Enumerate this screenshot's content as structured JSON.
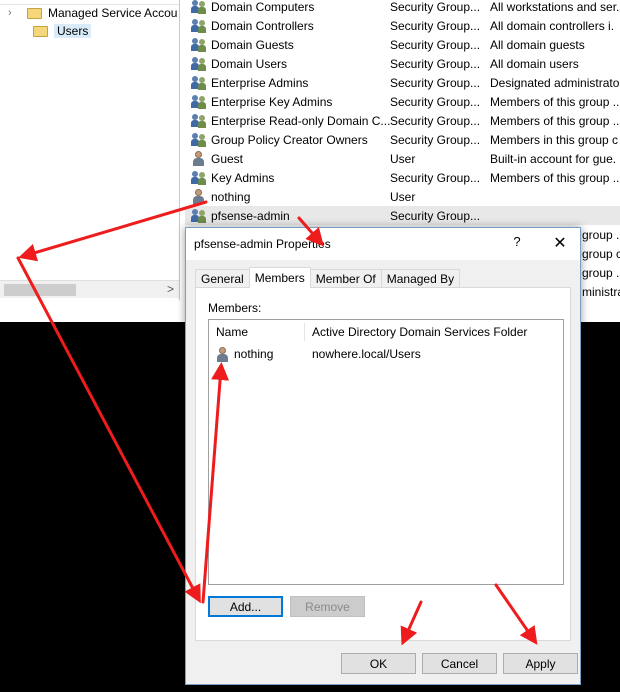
{
  "tree": {
    "items": [
      {
        "label": "Managed Service Accou",
        "icon": "folder-icon",
        "selected": false
      },
      {
        "label": "Users",
        "icon": "folder-icon",
        "selected": true
      }
    ],
    "scroll_right": ">"
  },
  "list": {
    "rows": [
      {
        "name": "Domain Computers",
        "type": "Security Group...",
        "desc": "All workstations and ser.",
        "icon": "group"
      },
      {
        "name": "Domain Controllers",
        "type": "Security Group...",
        "desc": "All domain controllers i.",
        "icon": "group"
      },
      {
        "name": "Domain Guests",
        "type": "Security Group...",
        "desc": "All domain guests",
        "icon": "group"
      },
      {
        "name": "Domain Users",
        "type": "Security Group...",
        "desc": "All domain users",
        "icon": "group"
      },
      {
        "name": "Enterprise Admins",
        "type": "Security Group...",
        "desc": "Designated administrato",
        "icon": "group"
      },
      {
        "name": "Enterprise Key Admins",
        "type": "Security Group...",
        "desc": "Members of this group ...",
        "icon": "group"
      },
      {
        "name": "Enterprise Read-only Domain C...",
        "type": "Security Group...",
        "desc": "Members of this group ...",
        "icon": "group"
      },
      {
        "name": "Group Policy Creator Owners",
        "type": "Security Group...",
        "desc": "Members in this group c",
        "icon": "group"
      },
      {
        "name": "Guest",
        "type": "User",
        "desc": "Built-in account for gue.",
        "icon": "user"
      },
      {
        "name": "Key Admins",
        "type": "Security Group...",
        "desc": "Members of this group ...",
        "icon": "group"
      },
      {
        "name": "nothing",
        "type": "User",
        "desc": "",
        "icon": "user"
      },
      {
        "name": "pfsense-admin",
        "type": "Security Group...",
        "desc": "",
        "icon": "group"
      }
    ],
    "clipped_right": [
      "group ...",
      "group can",
      "group ...",
      "ministrato"
    ]
  },
  "dialog": {
    "title": "pfsense-admin Properties",
    "help": "?",
    "close": "✕",
    "tabs": [
      "General",
      "Members",
      "Member Of",
      "Managed By"
    ],
    "active_tab": "Members",
    "members_label": "Members:",
    "columns": {
      "name": "Name",
      "folder": "Active Directory Domain Services Folder"
    },
    "members": [
      {
        "name": "nothing",
        "folder": "nowhere.local/Users"
      }
    ],
    "add_button": "Add...",
    "remove_button": "Remove",
    "ok_button": "OK",
    "cancel_button": "Cancel",
    "apply_button": "Apply"
  },
  "colors": {
    "annotation_arrow": "#ee1c1c",
    "selection": "#d9ebf9",
    "focus": "#0078d7"
  }
}
